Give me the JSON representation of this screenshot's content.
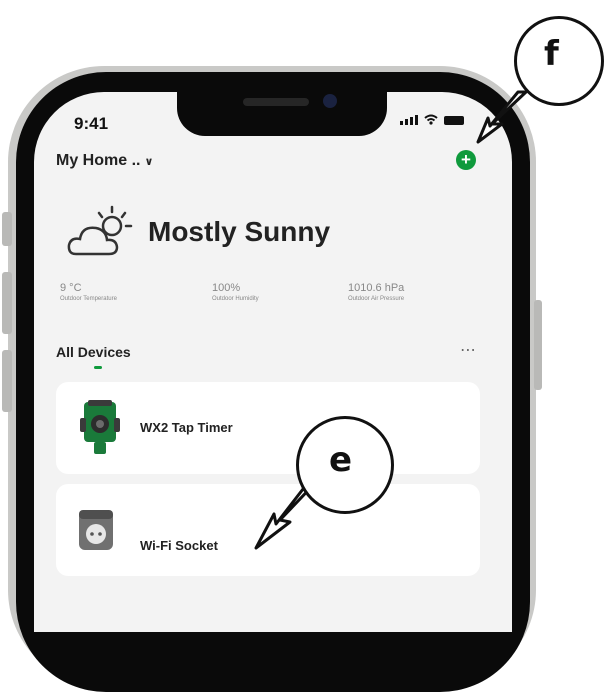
{
  "status_bar": {
    "time": "9:41"
  },
  "header": {
    "home_selector": "My Home ..",
    "chevron_icon": "chevron-down-icon",
    "add_button_icon": "plus-icon"
  },
  "weather": {
    "icon": "partly-sunny-icon",
    "condition": "Mostly Sunny",
    "stats": [
      {
        "value": "9 °C",
        "label": "Outdoor Temperature"
      },
      {
        "value": "100%",
        "label": "Outdoor Humidity"
      },
      {
        "value": "1010.6 hPa",
        "label": "Outdoor Air Pressure"
      }
    ]
  },
  "devices_section": {
    "title": "All Devices",
    "more_icon": "more-dots-icon"
  },
  "devices": [
    {
      "name": "WX2 Tap Timer",
      "icon": "tap-timer-icon"
    },
    {
      "name": "Wi-Fi Socket",
      "icon": "socket-icon"
    }
  ],
  "callouts": {
    "add_device": "f",
    "device_list": "e"
  },
  "colors": {
    "accent_green": "#0f9a3c",
    "screen_bg": "#f3f3f3",
    "card_bg": "#ffffff"
  }
}
